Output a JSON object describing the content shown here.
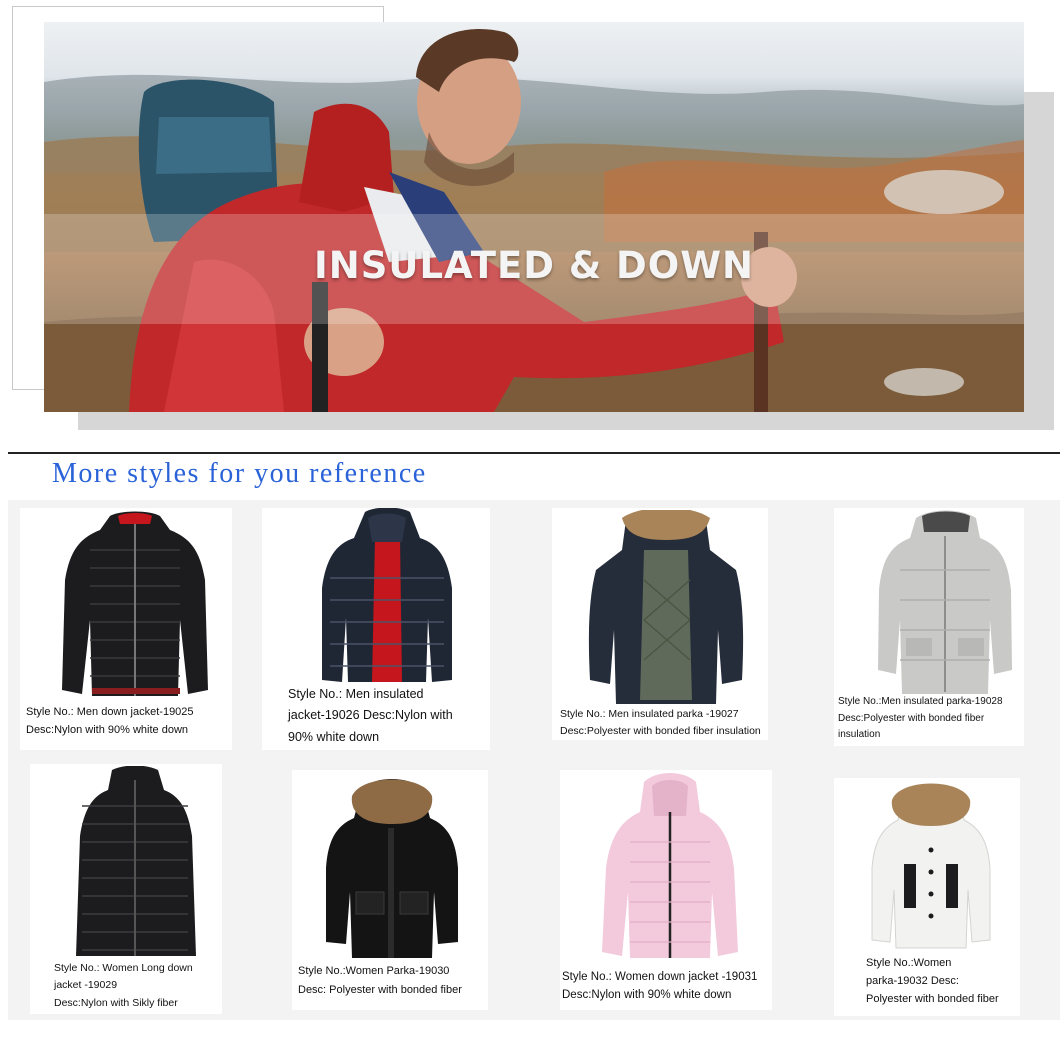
{
  "banner": {
    "title": "INSULATED & DOWN"
  },
  "section": {
    "heading": "More styles for you reference"
  },
  "products": [
    {
      "style_lines": [
        "Style No.: Men down jacket-19025",
        "Desc:Nylon with 90% white down"
      ],
      "item": "men-down-jacket"
    },
    {
      "style_lines": [
        "Style No.: Men insulated",
        "jacket-19026 Desc:Nylon with",
        "90% white down"
      ],
      "item": "men-insulated-jacket"
    },
    {
      "style_lines": [
        "Style No.: Men insulated parka -19027",
        "Desc:Polyester with bonded fiber insulation"
      ],
      "item": "men-insulated-parka"
    },
    {
      "style_lines": [
        "Style No.:Men insulated parka-19028",
        "Desc:Polyester with bonded fiber",
        "insulation"
      ],
      "item": "men-insulated-parka-grey"
    },
    {
      "style_lines": [
        "Style No.: Women Long down",
        "jacket -19029",
        "Desc:Nylon with Sikly fiber"
      ],
      "item": "women-long-down-jacket"
    },
    {
      "style_lines": [
        "Style No.:Women Parka-19030",
        "Desc: Polyester with bonded fiber"
      ],
      "item": "women-parka"
    },
    {
      "style_lines": [
        "Style No.: Women down jacket -19031",
        "Desc:Nylon with 90% white down"
      ],
      "item": "women-down-jacket"
    },
    {
      "style_lines": [
        "Style No.:Women",
        "parka-19032 Desc:",
        "Polyester with bonded fiber"
      ],
      "item": "women-parka-white"
    }
  ],
  "colors": {
    "heading": "#2a62d8",
    "jacket_black": "#1c1c1e",
    "jacket_navy": "#1f2735",
    "jacket_grey": "#c9cac8",
    "jacket_pink": "#f3c9dc",
    "jacket_white": "#f2f2f0",
    "fur": "#a88458",
    "lining_red": "#c4161c"
  }
}
